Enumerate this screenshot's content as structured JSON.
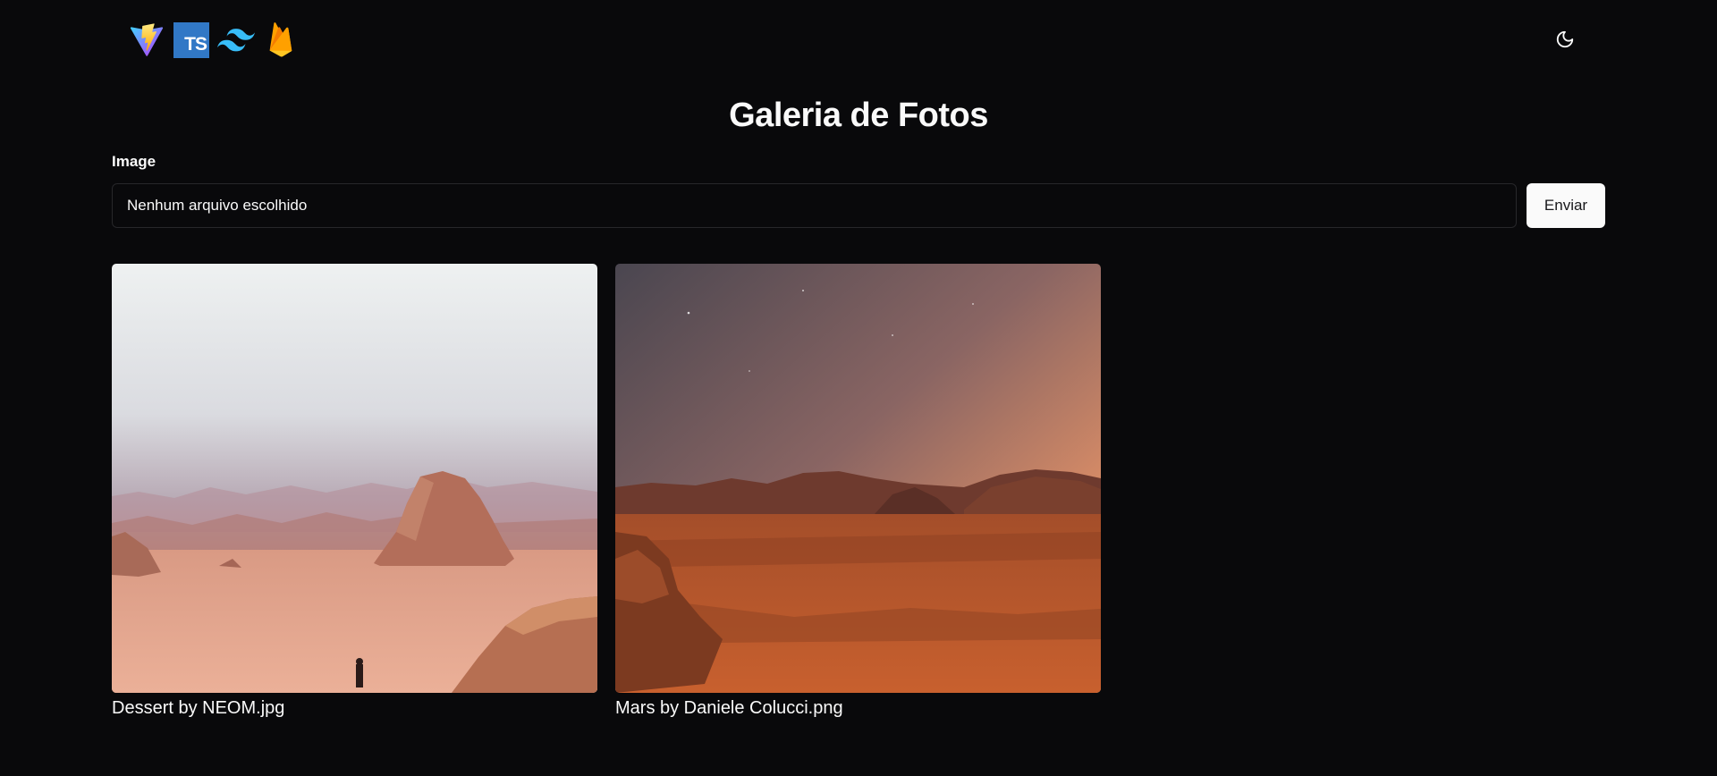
{
  "header": {
    "logos": [
      "vite-logo",
      "typescript-logo",
      "tailwind-logo",
      "firebase-logo"
    ],
    "ts_text": "TS",
    "theme_toggle_icon": "moon-icon"
  },
  "page": {
    "title": "Galeria de Fotos"
  },
  "upload_form": {
    "label": "Image",
    "file_input_value": "Nenhum arquivo escolhido",
    "submit_label": "Enviar"
  },
  "gallery": {
    "items": [
      {
        "caption": "Dessert by NEOM.jpg"
      },
      {
        "caption": "Mars by Daniele Colucci.png"
      }
    ]
  },
  "colors": {
    "background": "#09090b",
    "border": "#27272a",
    "foreground": "#fafafa",
    "typescript": "#3178c6",
    "tailwind": "#38bdf8"
  }
}
